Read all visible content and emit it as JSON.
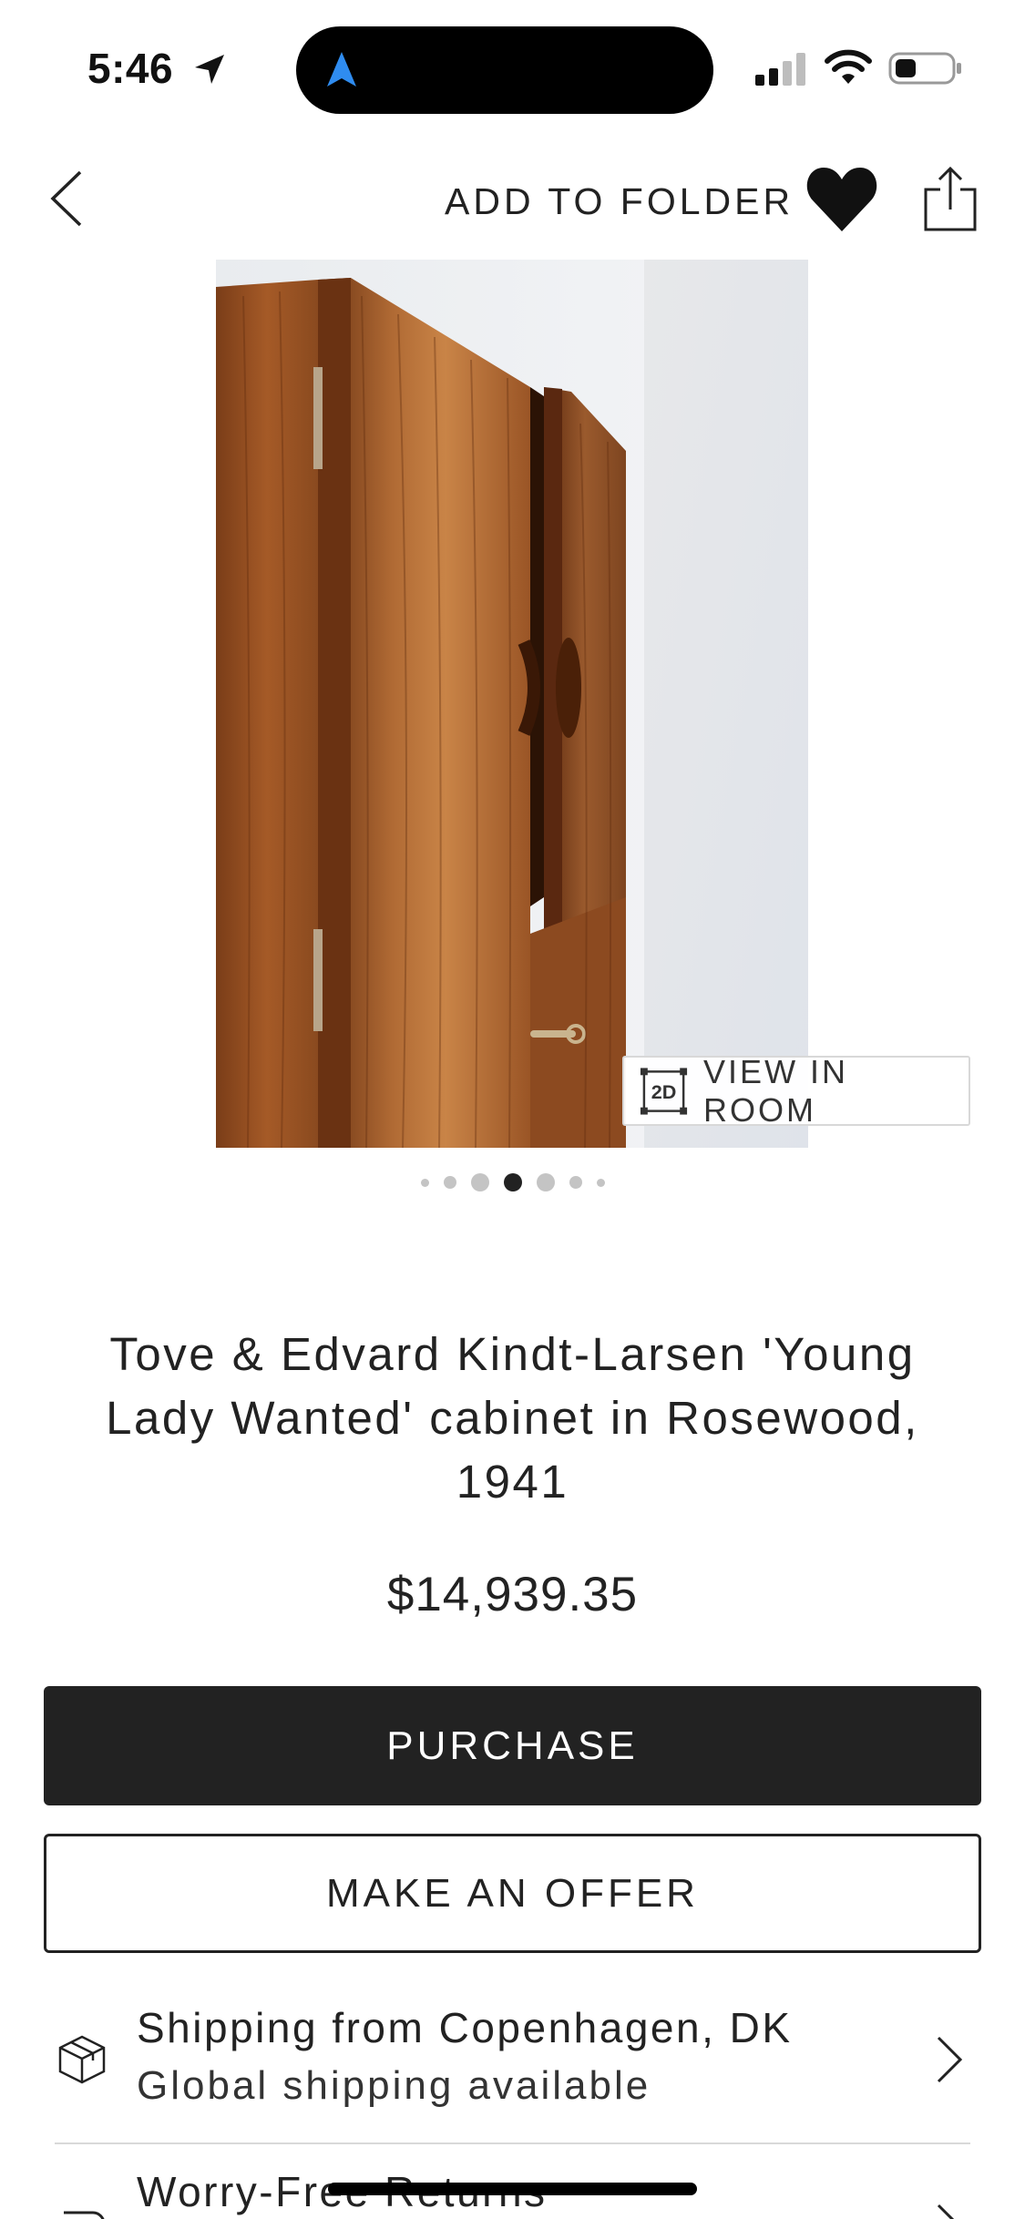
{
  "status_bar": {
    "time": "5:46",
    "icons": [
      "location-arrow-icon",
      "navigation-icon",
      "cellular-signal-icon",
      "wifi-icon",
      "battery-icon"
    ]
  },
  "header": {
    "back_icon": "chevron-left-icon",
    "add_to_folder_label": "ADD TO FOLDER",
    "favorite_icon": "heart-filled-icon",
    "share_icon": "share-icon"
  },
  "gallery": {
    "image_subject": "rosewood cabinet",
    "view_in_room_badge": "2D",
    "view_in_room_label": "VIEW IN ROOM",
    "dot_count": 7,
    "active_index": 3
  },
  "product": {
    "title": "Tove & Edvard Kindt-Larsen 'Young Lady Wanted' cabinet in Rosewood, 1941",
    "price": "$14,939.35"
  },
  "actions": {
    "purchase_label": "PURCHASE",
    "offer_label": "MAKE AN OFFER"
  },
  "info_rows": {
    "shipping_title": "Shipping from Copenhagen, DK",
    "shipping_subtitle": "Global shipping available",
    "returns_title": "Worry-Free Returns"
  },
  "colors": {
    "primary_button": "#222222",
    "text": "#222222",
    "island_accent": "#2f8cf0"
  }
}
